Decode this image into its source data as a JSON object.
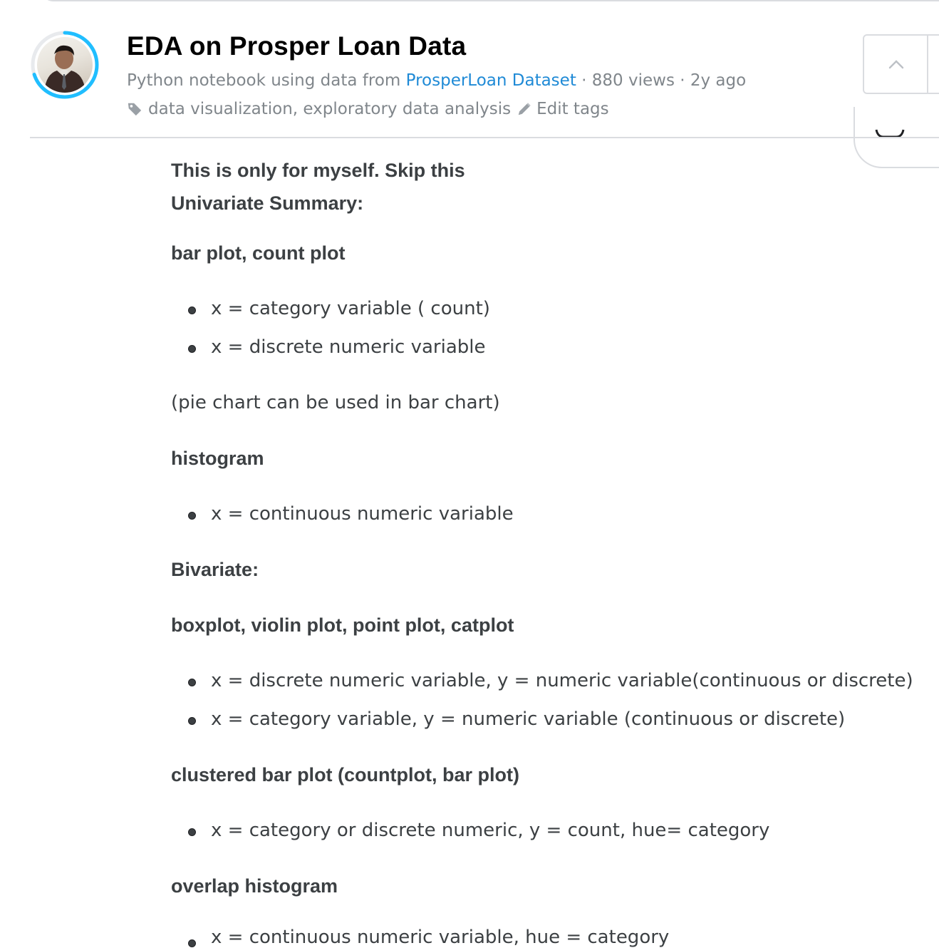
{
  "header": {
    "title": "EDA on Prosper Loan Data",
    "subtitle_prefix": "Python notebook using data from",
    "dataset_link": "ProsperLoan Dataset",
    "views": "· 880 views",
    "age": "· 2y ago",
    "tags": "data visualization, exploratory data analysis",
    "edit_tags": "Edit tags",
    "avatar_progress": 0.7,
    "accent_color": "#20beff",
    "link_color": "#1f8ad6"
  },
  "notebook": {
    "intro": "This is only for myself. Skip this",
    "univariate_heading": "Univariate Summary:",
    "bar_heading": "bar plot, count plot",
    "bar_items": [
      "x = category variable ( count)",
      "x = discrete numeric variable"
    ],
    "pie_note": "(pie chart can be used in bar chart)",
    "hist_heading": "histogram",
    "hist_items": [
      "x = continuous numeric variable"
    ],
    "bivariate_heading": "Bivariate:",
    "box_heading": "boxplot, violin plot, point plot, catplot",
    "box_items": [
      "x = discrete numeric variable, y = numeric variable(continuous or discrete)",
      "x = category variable, y = numeric variable (continuous or discrete)"
    ],
    "clustered_heading": "clustered bar plot (countplot, bar plot)",
    "clustered_items": [
      "x = category or discrete numeric, y = count, hue= category"
    ],
    "overlap_heading": "overlap histogram",
    "overlap_items": [
      "x = continuous numeric variable, hue = category"
    ]
  }
}
